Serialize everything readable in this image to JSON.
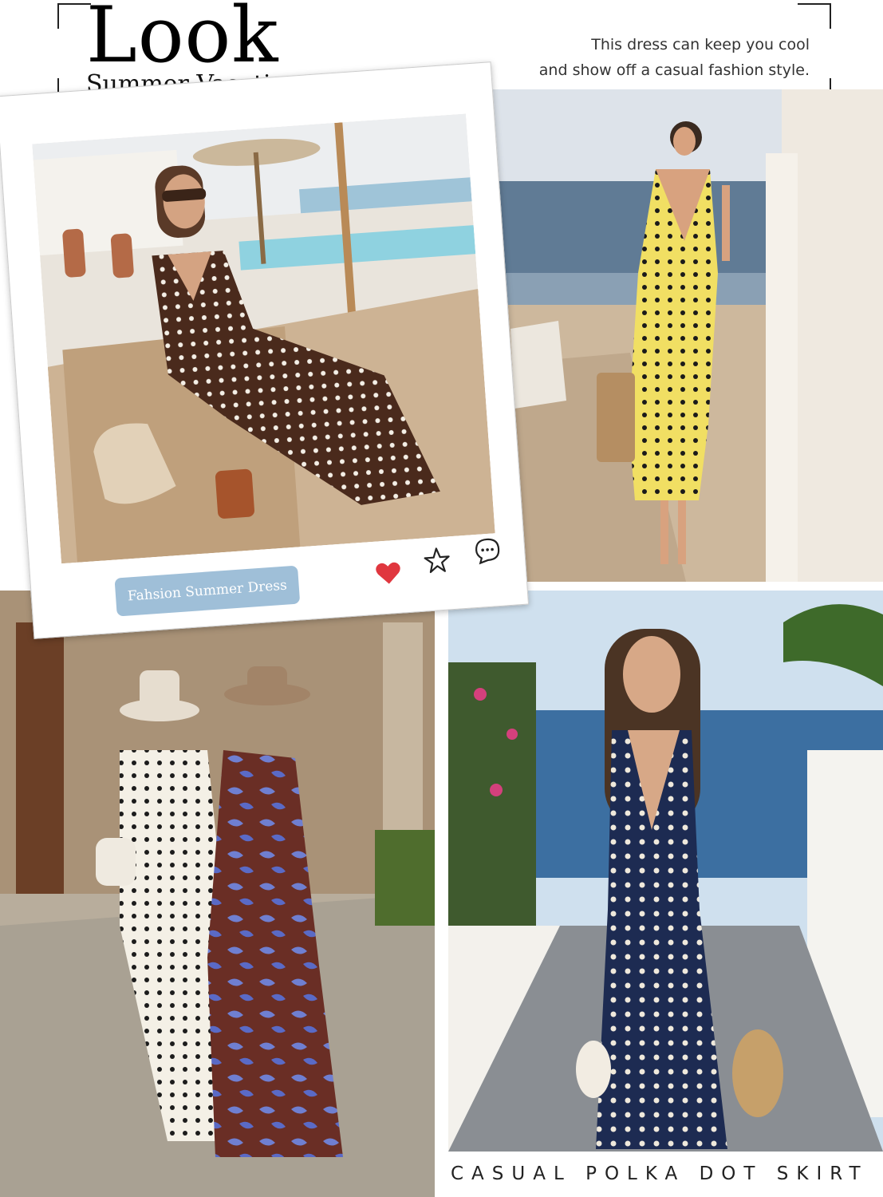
{
  "header": {
    "title": "Look",
    "subtitle": "Summer Vacation Dress",
    "description_line1": "This dress can keep you cool",
    "description_line2": "and show off a casual fashion style."
  },
  "polaroid": {
    "tag_label": "Fahsion Summer Dress",
    "icons": [
      "heart-icon",
      "star-icon",
      "comment-icon"
    ],
    "heart_color": "#e0373f"
  },
  "caption": "CASUAL POLKA DOT SKIRT",
  "colors": {
    "tag_bg": "#9fbfd8",
    "brown_dress": "#4a2a1c",
    "yellow_dress": "#f1df63",
    "navy_dress": "#1d2b52"
  }
}
